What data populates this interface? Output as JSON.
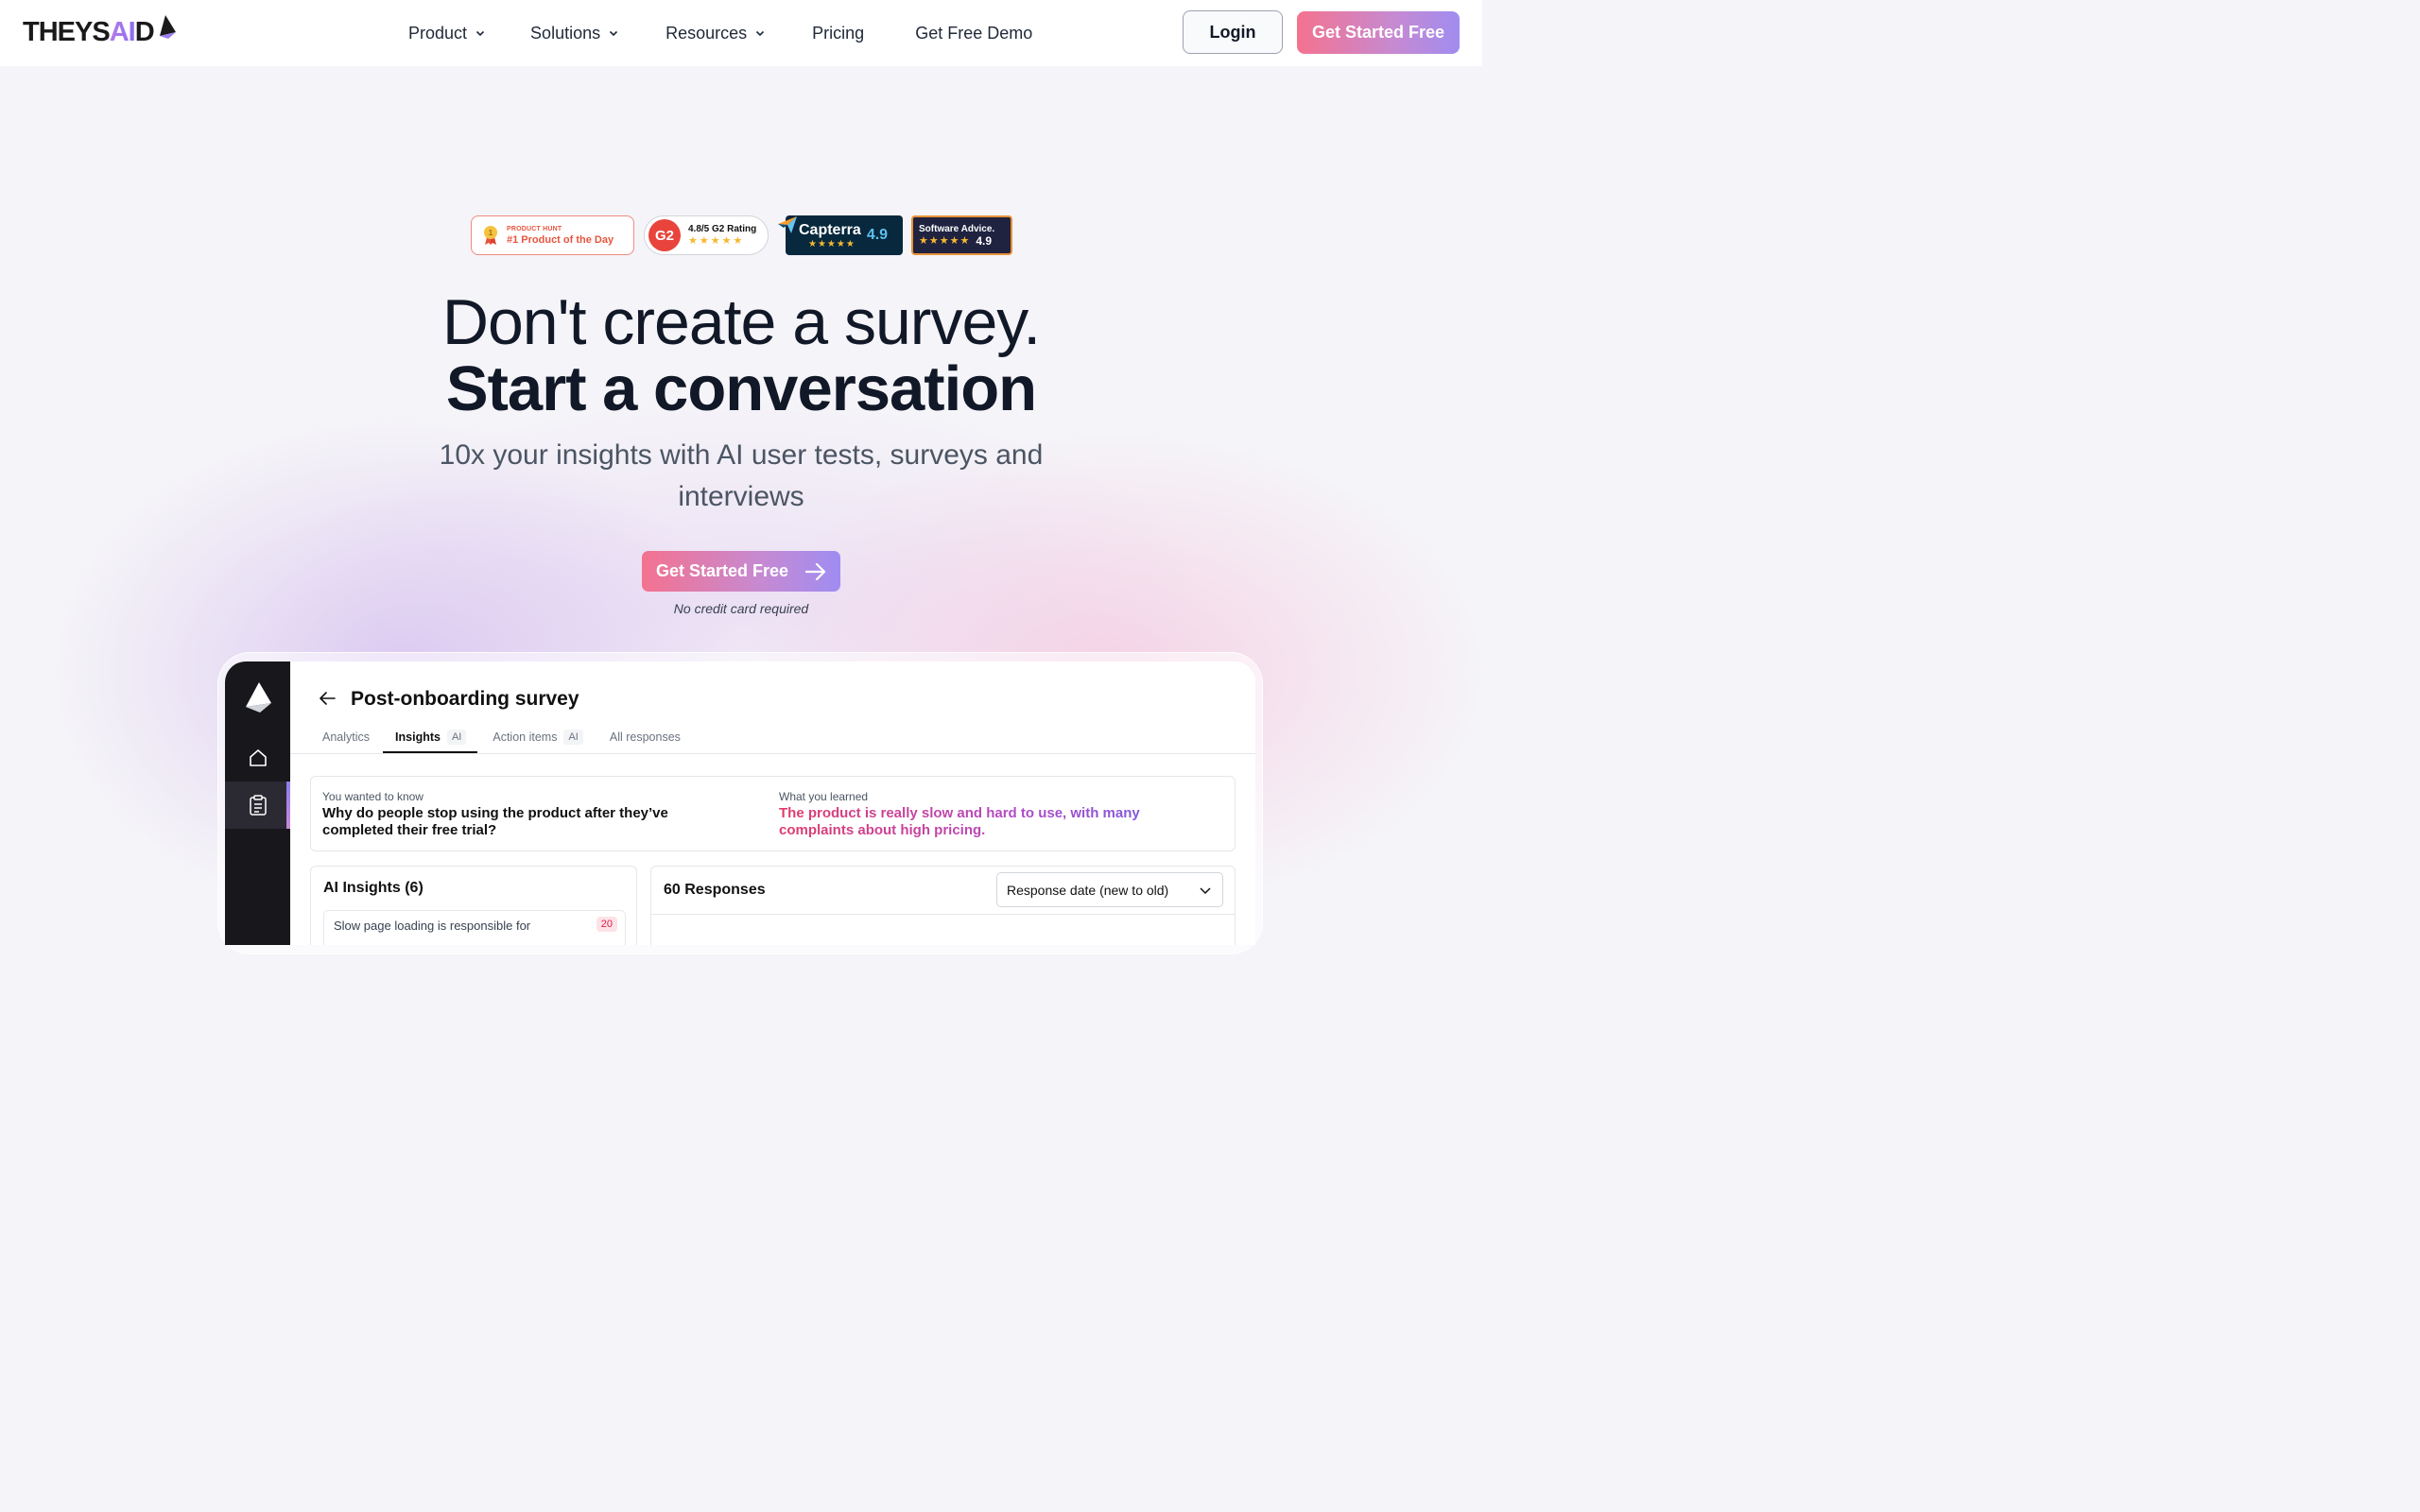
{
  "brand": {
    "name_part1": "THEYS",
    "name_part2": "AI",
    "name_part3": "D",
    "accent_pink": "#f4728f",
    "accent_purple": "#9f8cf2"
  },
  "nav": {
    "items": [
      {
        "label": "Product",
        "dropdown": true
      },
      {
        "label": "Solutions",
        "dropdown": true
      },
      {
        "label": "Resources",
        "dropdown": true
      },
      {
        "label": "Pricing",
        "dropdown": false
      },
      {
        "label": "Get Free Demo",
        "dropdown": false
      }
    ],
    "login_label": "Login",
    "cta_label": "Get Started Free"
  },
  "badges": {
    "product_hunt": {
      "small": "PRODUCT HUNT",
      "big": "#1 Product of the Day"
    },
    "g2": {
      "logo": "G2",
      "text": "4.8/5 G2 Rating",
      "stars": "★★★★★"
    },
    "capterra": {
      "name": "Capterra",
      "score": "4.9",
      "stars": "★★★★★"
    },
    "software_advice": {
      "name": "Software Advice.",
      "score": "4.9",
      "stars": "★★★★★"
    }
  },
  "hero": {
    "line1": "Don't create a survey.",
    "line2": "Start a conversation",
    "subtitle": "10x your insights with AI user tests, surveys and interviews",
    "cta_label": "Get Started Free",
    "note": "No credit card required"
  },
  "app": {
    "title": "Post-onboarding survey",
    "tabs": [
      {
        "label": "Analytics",
        "chip": ""
      },
      {
        "label": "Insights",
        "chip": "AI",
        "active": true
      },
      {
        "label": "Action items",
        "chip": "AI"
      },
      {
        "label": "All responses",
        "chip": ""
      }
    ],
    "know_label": "You wanted to know",
    "know_question": "Why do people stop using the product after they’ve completed their free trial?",
    "learn_label": "What you learned",
    "learn_answer": "The product is really slow and hard to use, with many complaints about high pricing.",
    "insights_title": "AI Insights (6)",
    "insight_item": "Slow page loading is responsible for",
    "insight_count": "20",
    "responses_title": "60 Responses",
    "sort_value": "Response date (new to old)"
  }
}
